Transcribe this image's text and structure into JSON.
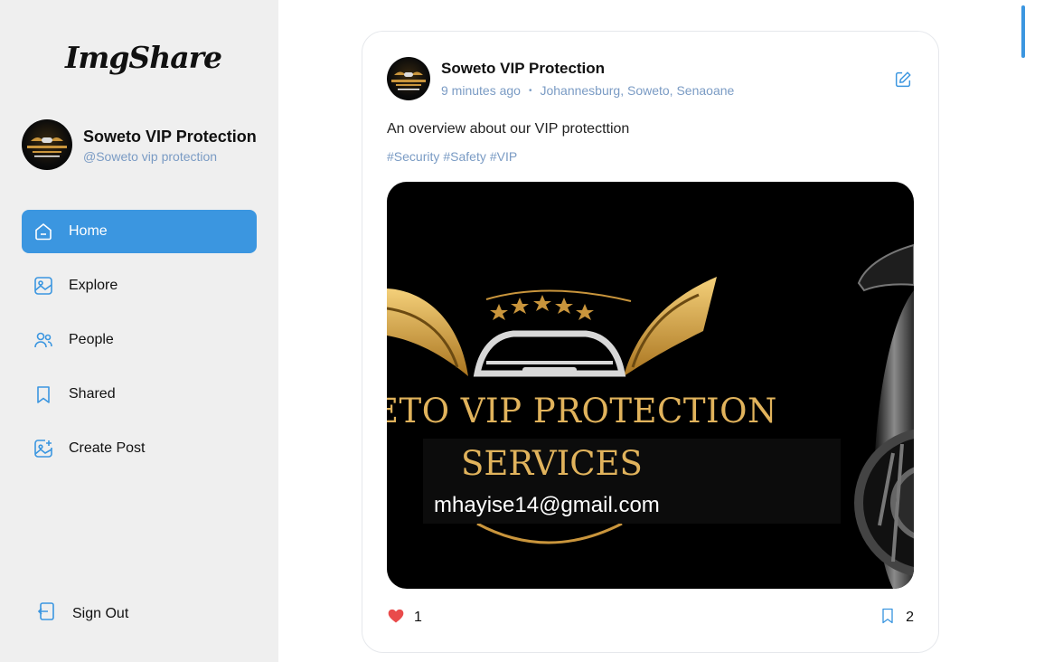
{
  "app": {
    "logo": "ImgShare"
  },
  "user": {
    "name": "Soweto VIP Protection",
    "handle": "@Soweto vip protection"
  },
  "nav": {
    "items": [
      {
        "label": "Home",
        "icon": "home-icon",
        "active": true
      },
      {
        "label": "Explore",
        "icon": "explore-icon",
        "active": false
      },
      {
        "label": "People",
        "icon": "people-icon",
        "active": false
      },
      {
        "label": "Shared",
        "icon": "bookmark-icon",
        "active": false
      },
      {
        "label": "Create Post",
        "icon": "create-post-icon",
        "active": false
      }
    ],
    "sign_out": "Sign Out"
  },
  "post": {
    "author": "Soweto VIP Protection",
    "time": "9 minutes ago",
    "separator": "•",
    "location": "Johannesburg, Soweto, Senaoane",
    "caption": "An overview about our VIP protecttion",
    "tags": [
      "#Security",
      "#Safety",
      "#VIP"
    ],
    "image": {
      "line1": "ETO VIP PROTECTION",
      "line2": "SERVICES",
      "email": "mhayise14@gmail.com"
    },
    "likes": "1",
    "saves": "2"
  },
  "colors": {
    "accent": "#3b96e0",
    "muted": "#7a9bc4",
    "sidebar": "#efefef",
    "like": "#e94b4b",
    "gold": "#e1b35c"
  }
}
